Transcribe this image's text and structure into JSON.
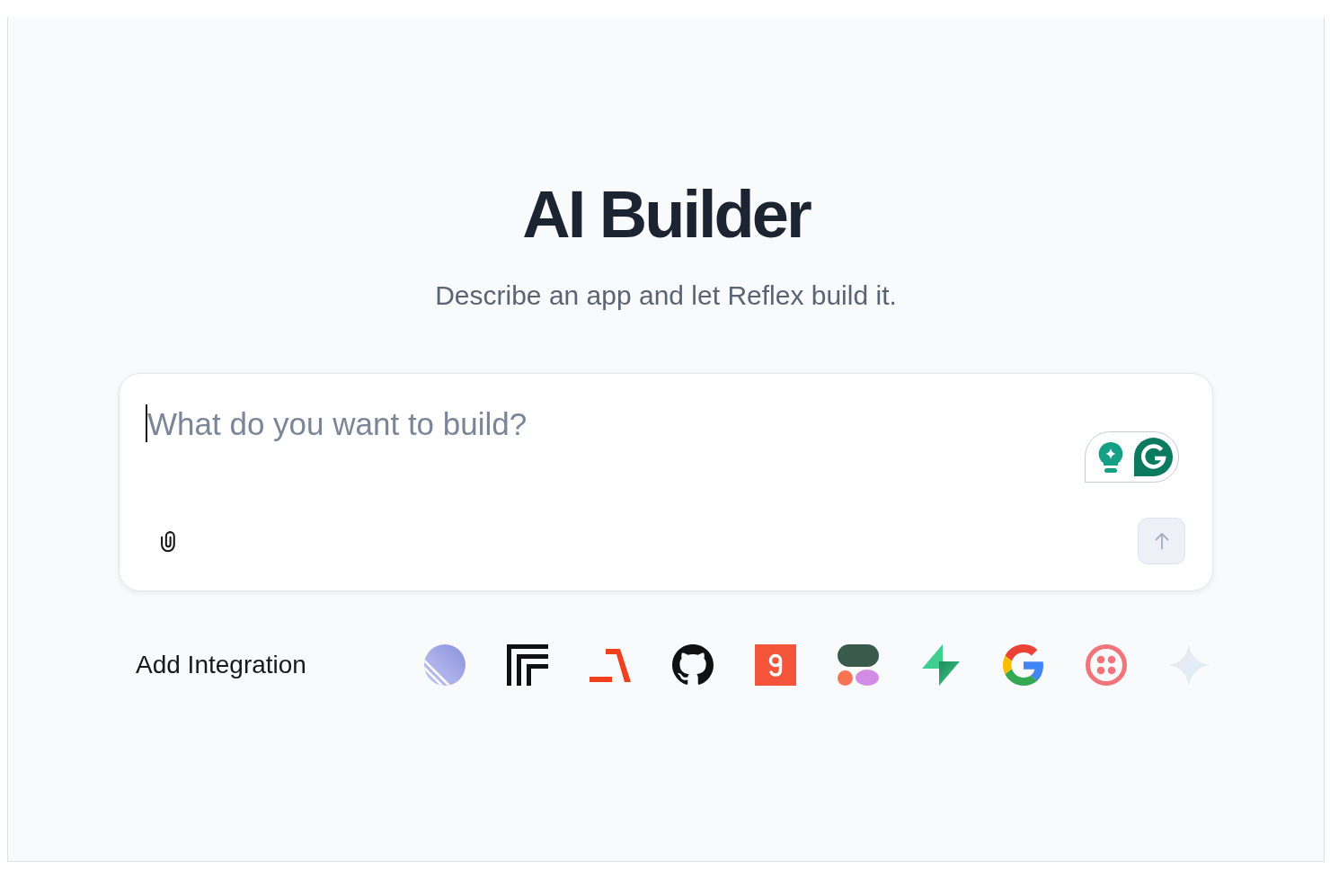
{
  "page": {
    "title": "AI Builder",
    "subtitle": "Describe an app and let Reflex build it."
  },
  "prompt": {
    "placeholder": "What do you want to build?",
    "focused": true
  },
  "send_button": {
    "disabled": true
  },
  "integrations": {
    "label": "Add Integration"
  }
}
